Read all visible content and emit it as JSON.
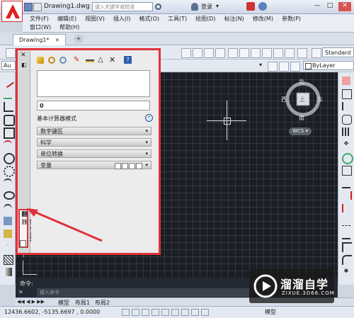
{
  "title": {
    "filename": "Drawing1.dwg",
    "search_placeholder": "键入关键字或短语",
    "login": "登录"
  },
  "menu": {
    "row1": [
      "文件(F)",
      "编辑(E)",
      "视图(V)",
      "插入(I)",
      "格式(O)",
      "工具(T)",
      "绘图(D)",
      "标注(N)",
      "修改(M)",
      "参数(P)"
    ],
    "row2": [
      "窗口(W)",
      "帮助(H)"
    ]
  },
  "tabs": {
    "active": "Drawing1*"
  },
  "toolbar": {
    "standard": "Standard",
    "bylayer": "ByLayer",
    "au": "Au"
  },
  "palette": {
    "input_value": "0",
    "mode_label": "基本计算器模式",
    "sections": [
      "数字键区",
      "科学",
      "单位转换",
      "变量"
    ],
    "strip_label": "快速计算器",
    "strip_sub": "翻"
  },
  "compass": {
    "north": "北",
    "south": "南",
    "west": "西",
    "east": "东",
    "top": "上",
    "wcs": "WCS"
  },
  "command": {
    "prompt": "命令:",
    "input_placeholder": "键入命令"
  },
  "layout": {
    "model": "模型",
    "layout1": "布局1",
    "layout2": "布局2"
  },
  "status": {
    "coords": "12436.6602, -5135.6697 , 0.0000",
    "model": "模型"
  },
  "watermark": {
    "name": "溜溜自学",
    "url": "ZIXUE.3D66.COM"
  },
  "colors": {
    "accent_red": "#e0323a",
    "canvas": "#1b1e24"
  }
}
